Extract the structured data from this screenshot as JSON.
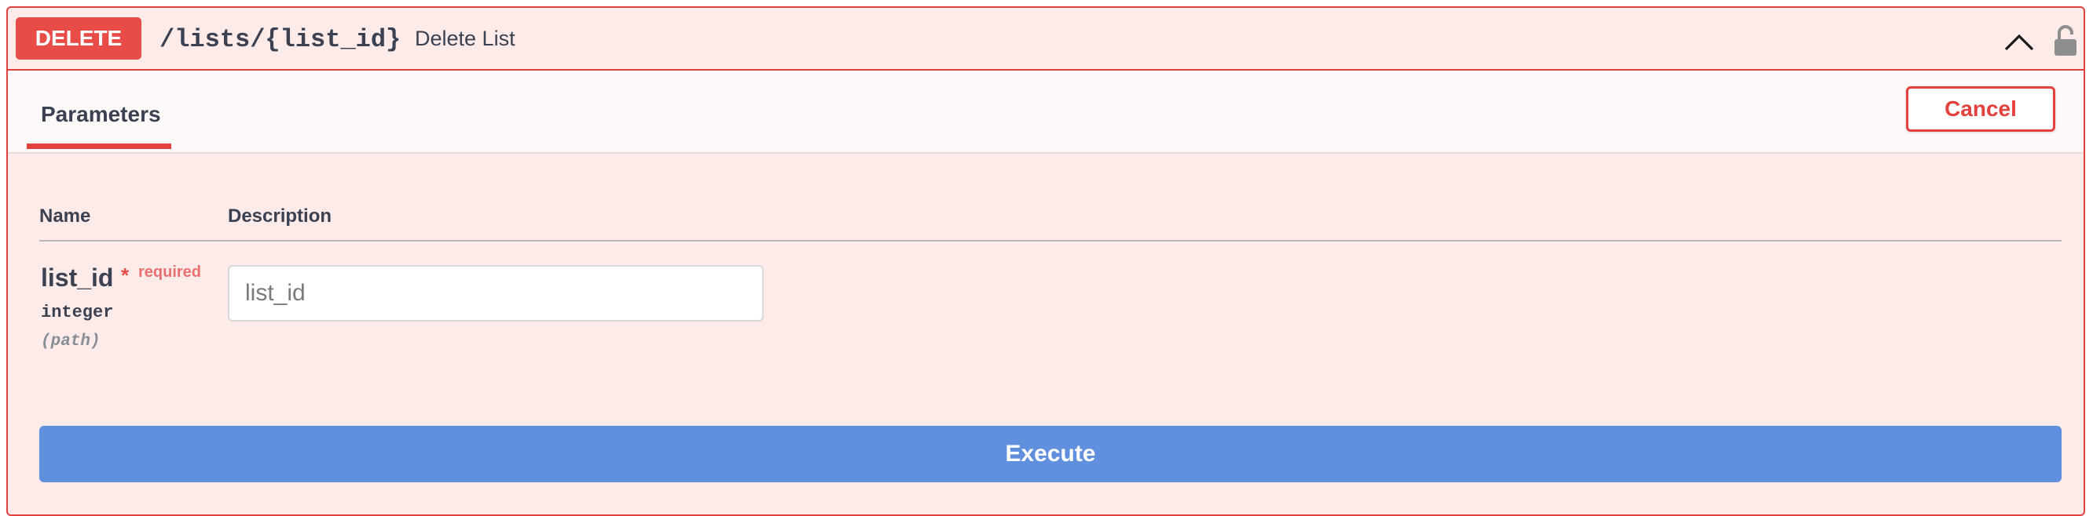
{
  "operation": {
    "method": "DELETE",
    "path": "/lists/{list_id}",
    "summary": "Delete List",
    "colors": {
      "method": "#e84c47",
      "border": "#e3413d",
      "background": "#fdebea",
      "execute": "#5f8fdd"
    }
  },
  "icons": {
    "collapse": "chevron-up-icon",
    "auth": "unlocked-padlock-icon"
  },
  "tabs": {
    "parameters_label": "Parameters",
    "cancel_label": "Cancel"
  },
  "table": {
    "headers": {
      "name": "Name",
      "description": "Description"
    },
    "parameters": [
      {
        "name": "list_id",
        "required_mark": "*",
        "required_label": "required",
        "type": "integer",
        "in": "(path)",
        "placeholder": "list_id",
        "value": ""
      }
    ]
  },
  "execute_label": "Execute"
}
